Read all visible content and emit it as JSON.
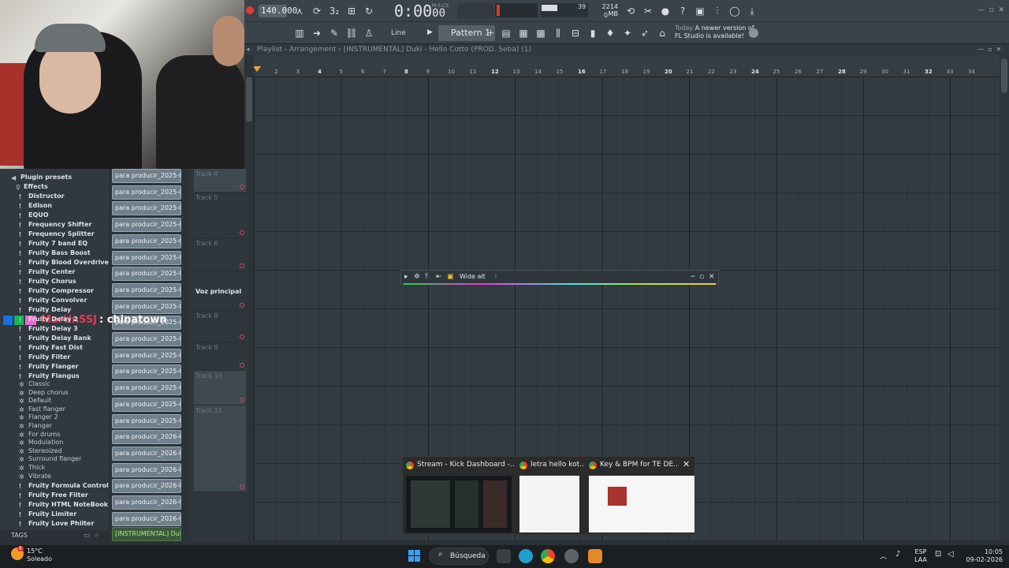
{
  "toolbar": {
    "tempo": "140.000",
    "time": "0:00",
    "time_sub": "00",
    "time_unit": "M:S:CS",
    "cpu_value": "39",
    "memory": "2214 MB",
    "memory_sub": "0",
    "line_mode": "Line",
    "pattern": "Pattern 1",
    "news_today": "Today",
    "news_text": "A newer version of",
    "news_text2": "FL Studio is available!"
  },
  "playlist": {
    "title": "Playlist - Arrangement",
    "project": "[INSTRUMENTAL] Duki - Hello Cotto (PROD. Seba) (1)",
    "ruler": [
      "2",
      "3",
      "4",
      "5",
      "6",
      "7",
      "8",
      "9",
      "10",
      "11",
      "12",
      "13",
      "14",
      "15",
      "16",
      "17",
      "18",
      "19",
      "20",
      "21",
      "22",
      "23",
      "24",
      "25",
      "26",
      "27",
      "28",
      "29",
      "30",
      "31",
      "32",
      "33",
      "34"
    ]
  },
  "browser": {
    "plugin_presets": "Plugin presets",
    "effects": "Effects",
    "items": [
      "Distructor",
      "Edison",
      "EQUO",
      "Frequency Shifter",
      "Frequency Splitter",
      "Fruity 7 band EQ",
      "Fruity Bass Boost",
      "Fruity Blood Overdrive",
      "Fruity Center",
      "Fruity Chorus",
      "Fruity Compressor",
      "Fruity Convolver",
      "Fruity Delay",
      "Fruity Delay 2",
      "Fruity Delay 3",
      "Fruity Delay Bank",
      "Fruity Fast Dist",
      "Fruity Filter",
      "Fruity Flanger",
      "Fruity Flangus"
    ],
    "presets": [
      "Classic",
      "Deep chorus",
      "Default",
      "Fast flanger",
      "Flanger 2",
      "Flanger",
      "For drums",
      "Modulation",
      "Stereoized",
      "Surround flanger",
      "Thick",
      "Vibrate"
    ],
    "items2": [
      "Fruity Formula Controller",
      "Fruity Free Filter",
      "Fruity HTML NoteBook",
      "Fruity Limiter",
      "Fruity Love Philter"
    ],
    "tags": "TAGS"
  },
  "clips": {
    "items": [
      "para producir_2025-06-...",
      "para producir_2025-06-...",
      "para producir_2025-06-...",
      "para producir_2025-06-...",
      "para producir_2025-06-...",
      "para producir_2025-06-...",
      "para producir_2025-06-...",
      "para producir_2025-06-...",
      "para producir_2025-06-...",
      "para producir_2025-06-...",
      "para producir_2025-06-...",
      "para producir_2025-06-...",
      "para producir_2025-06-...",
      "para producir_2025-06-...",
      "para producir_2025-06-...",
      "para producir_2025-06-...",
      "para producir_2026-02-...",
      "para producir_2026-02-...",
      "para producir_2026-02-...",
      "para producir_2026-02-...",
      "para producir_2026-02-...",
      "para producir_2026-02-..."
    ],
    "selected": "[INSTRUMENTAL] Duki..."
  },
  "tracks": [
    "Track 4",
    "Track 5",
    "Track 6",
    "Voz principal",
    "Track 8",
    "Track 9",
    "Track 10",
    "Track 11"
  ],
  "floating_window": {
    "title": "Wide alt"
  },
  "chat": {
    "user": "MartinSSJ",
    "message": ": chinatown"
  },
  "thumbnails": [
    {
      "title": "Stream - Kick Dashboard -..."
    },
    {
      "title": "letra hello kot..."
    },
    {
      "title": "Key & BPM for TE DE..."
    }
  ],
  "taskbar": {
    "temp": "15°C",
    "weather": "Soleado",
    "search": "Búsqueda",
    "lang1": "ESP",
    "lang2": "LAA",
    "time": "10:05",
    "date": "09-02-2026",
    "badge": "6"
  },
  "colors": {
    "accent_orange": "#e9a43a",
    "record_red": "#e03b3b",
    "chat_user": "#e3394e",
    "selected_clip_text": "#9ef08a"
  }
}
